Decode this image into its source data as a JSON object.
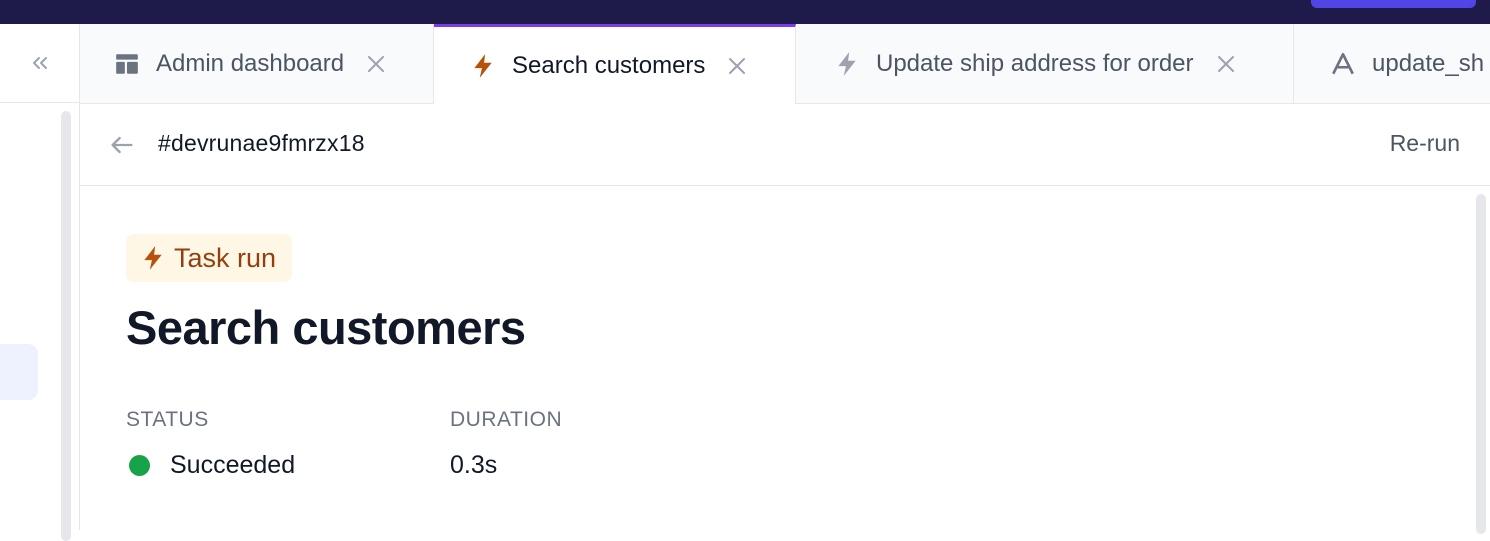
{
  "colors": {
    "accent": "#7c3aed",
    "topbar": "#1e1b4b",
    "task_badge_bg": "#fef7e6",
    "task_badge_text": "#92400e",
    "task_icon": "#b45309",
    "success": "#16a34a"
  },
  "sidebar": {
    "collapse_icon": "chevrons-left-icon"
  },
  "tabs": [
    {
      "label": "Admin dashboard",
      "icon": "layout-icon",
      "active": false
    },
    {
      "label": "Search customers",
      "icon": "lightning-icon",
      "active": true
    },
    {
      "label": "Update ship address for order",
      "icon": "lightning-icon",
      "active": false
    },
    {
      "label": "update_sh",
      "icon": "airplane-logo-icon",
      "active": false
    }
  ],
  "header": {
    "run_id": "#devrunae9fmrzx18",
    "rerun_label": "Re-run"
  },
  "main": {
    "badge_label": "Task run",
    "title": "Search customers",
    "status_label": "STATUS",
    "status_value": "Succeeded",
    "duration_label": "DURATION",
    "duration_value": "0.3s"
  }
}
